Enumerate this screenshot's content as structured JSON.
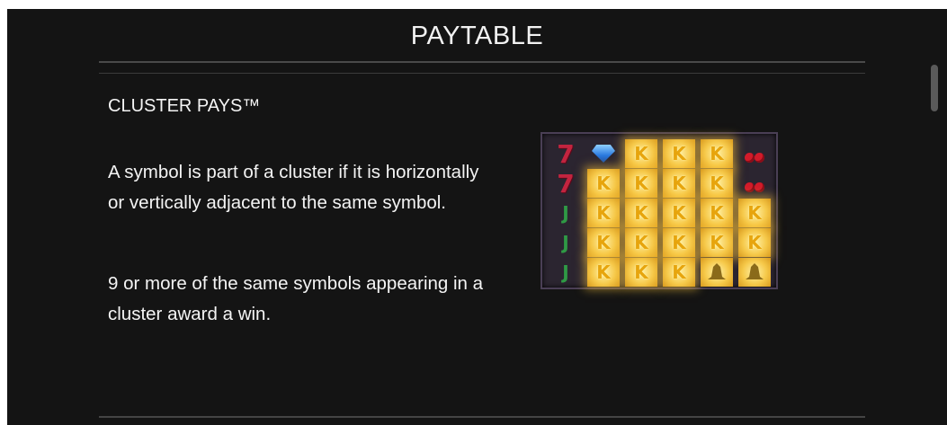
{
  "header": {
    "title": "PAYTABLE"
  },
  "section": {
    "title": "CLUSTER PAYS™",
    "paragraphs": [
      "A symbol is part of a cluster if it is horizontally or vertically adjacent to the same symbol.",
      "9 or more of the same symbols appearing in a cluster award a win."
    ]
  },
  "example_grid": {
    "rows": [
      [
        "seven",
        "diamond",
        "k",
        "k",
        "k",
        "cherry"
      ],
      [
        "seven",
        "k",
        "k",
        "k",
        "k",
        "cherry"
      ],
      [
        "j",
        "k",
        "k",
        "k",
        "k",
        "k"
      ],
      [
        "j",
        "k",
        "k",
        "k",
        "k",
        "k"
      ],
      [
        "j",
        "k",
        "k",
        "k",
        "bell",
        "bell"
      ]
    ],
    "symbol_glyphs": {
      "seven": "7",
      "k": "K",
      "j": "J"
    },
    "highlight_color": "#f6c94a"
  }
}
